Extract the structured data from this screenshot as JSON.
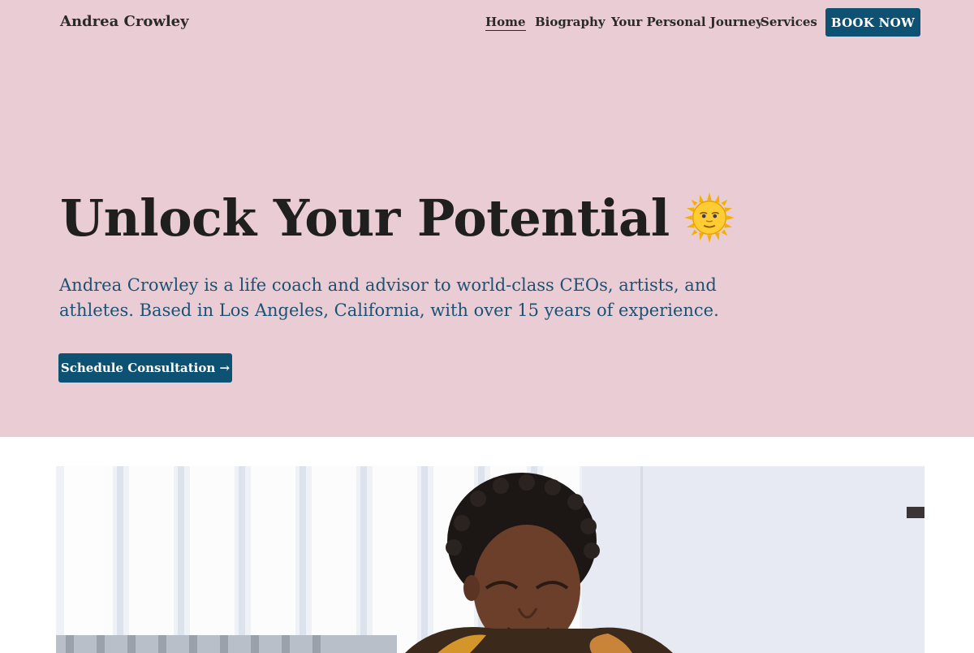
{
  "header": {
    "site_title": "Andrea Crowley",
    "nav": {
      "home": "Home",
      "biography": "Biography",
      "journey": "Your Personal Journey",
      "services": "Services"
    },
    "book_label": "BOOK NOW"
  },
  "hero": {
    "headline": "Unlock Your Potential",
    "emoji_icon": "sun-with-face-icon",
    "lede": "Andrea Crowley is a life coach and advisor to world-class CEOs, artists, and athletes. Based in Los Angeles, California, with over 15 years of experience.",
    "cta_label": "Schedule Consultation →"
  },
  "colors": {
    "hero_bg": "#eacdd4",
    "accent": "#0d5273",
    "lede_text": "#1b5173"
  }
}
